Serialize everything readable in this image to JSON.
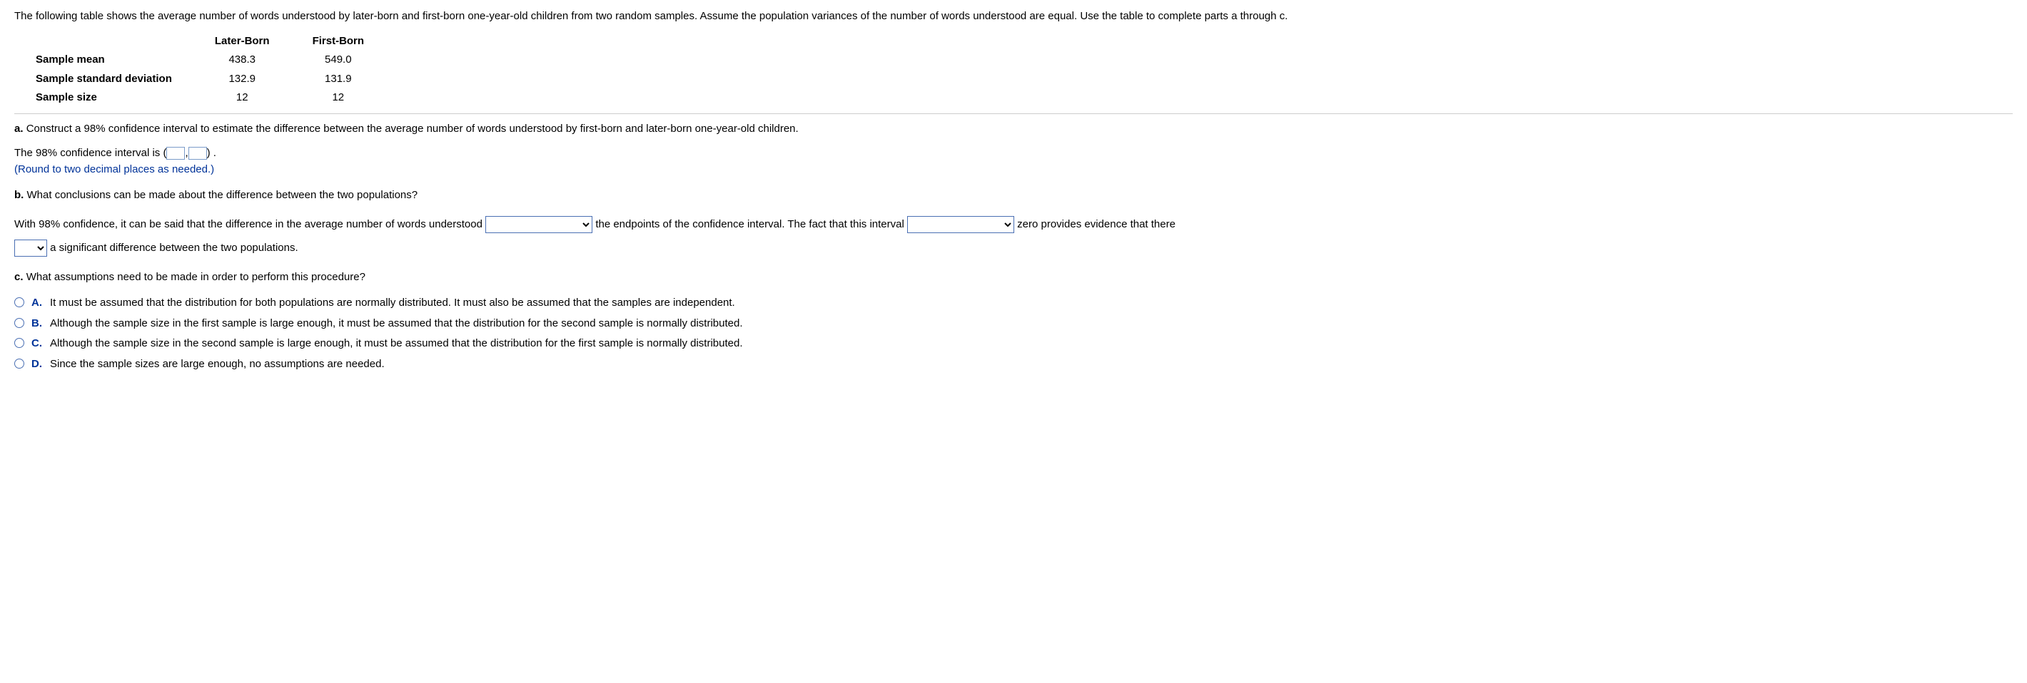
{
  "intro": "The following table shows the average number of words understood by later-born and first-born one-year-old children from two random samples. Assume the population variances of the number of words understood are equal. Use the table to complete parts a through c.",
  "table": {
    "headers": {
      "col1": "Later-Born",
      "col2": "First-Born"
    },
    "rows": [
      {
        "label": "Sample mean",
        "v1": "438.3",
        "v2": "549.0"
      },
      {
        "label": "Sample standard deviation",
        "v1": "132.9",
        "v2": "131.9"
      },
      {
        "label": "Sample size",
        "v1": "12",
        "v2": "12"
      }
    ]
  },
  "partA": {
    "label": "a.",
    "text": "Construct a 98% confidence interval to estimate the difference between the average number of words understood by first-born and later-born one-year-old children.",
    "ciPrefix": "The 98% confidence interval is",
    "openParen": "(",
    "comma": ",",
    "closeParen": ")",
    "period": ".",
    "roundNote": "(Round to two decimal places as needed.)"
  },
  "partB": {
    "label": "b.",
    "text": "What conclusions can be made about the difference between the two populations?",
    "seg1": "With 98% confidence, it can be said that the difference in the average number of words understood",
    "seg2": "the endpoints of the confidence interval. The fact that this interval",
    "seg3": "zero provides evidence that there",
    "seg4": "a significant difference between the two populations."
  },
  "partC": {
    "label": "c.",
    "text": "What assumptions need to be made in order to perform this procedure?",
    "options": [
      {
        "letter": "A.",
        "text": "It must be assumed that the distribution for both populations are normally distributed. It must also be assumed that the samples are independent."
      },
      {
        "letter": "B.",
        "text": "Although the sample size in the first sample is large enough, it must be assumed that the distribution for the second sample is normally distributed."
      },
      {
        "letter": "C.",
        "text": "Although the sample size in the second sample is large enough, it must be assumed that the distribution for the first sample is normally distributed."
      },
      {
        "letter": "D.",
        "text": "Since the sample sizes are large enough, no assumptions are needed."
      }
    ]
  }
}
